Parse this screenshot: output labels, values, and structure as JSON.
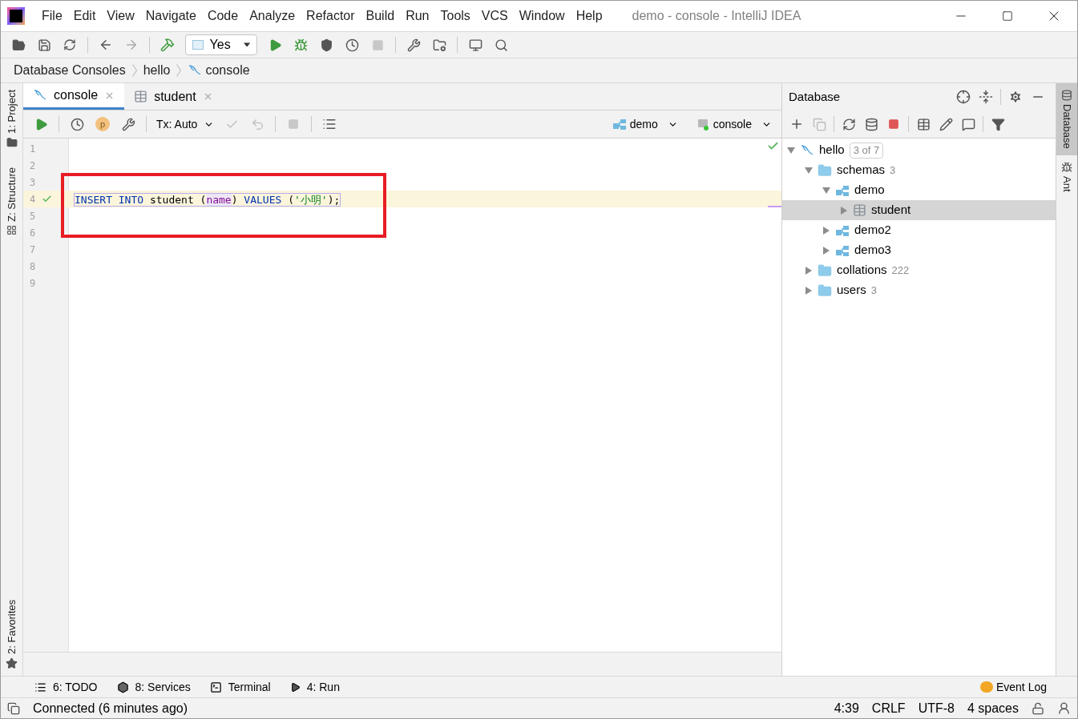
{
  "window": {
    "title": "demo - console - IntelliJ IDEA"
  },
  "menu": [
    "File",
    "Edit",
    "View",
    "Navigate",
    "Code",
    "Analyze",
    "Refactor",
    "Build",
    "Run",
    "Tools",
    "VCS",
    "Window",
    "Help"
  ],
  "toolbar": {
    "run_config": "Yes"
  },
  "breadcrumbs": [
    {
      "label": "Database Consoles",
      "kind": "plain"
    },
    {
      "label": "hello",
      "kind": "plain"
    },
    {
      "label": "console",
      "kind": "console"
    }
  ],
  "left_tool_windows": [
    {
      "label": "1: Project",
      "kind": "project"
    },
    {
      "label": "Z: Structure",
      "kind": "structure"
    },
    {
      "label": "2: Favorites",
      "kind": "favorites"
    }
  ],
  "editor_tabs": [
    {
      "label": "console",
      "kind": "console",
      "selected": true
    },
    {
      "label": "student",
      "kind": "table",
      "selected": false
    }
  ],
  "editor_toolbar": {
    "parameters": "p",
    "transaction": "Tx: Auto",
    "schema": "demo",
    "session": "console"
  },
  "editor": {
    "lines": [
      {
        "number": "1",
        "current": false
      },
      {
        "number": "2",
        "current": false
      },
      {
        "number": "3",
        "current": false
      },
      {
        "number": "4",
        "current": true,
        "executed": true,
        "tokens": [
          {
            "text": "INSERT INTO",
            "kind": "keyword"
          },
          {
            "text": " student (",
            "kind": "plain"
          },
          {
            "text": "name",
            "kind": "column"
          },
          {
            "text": ") ",
            "kind": "plain"
          },
          {
            "text": "VALUES",
            "kind": "keyword"
          },
          {
            "text": " (",
            "kind": "plain"
          },
          {
            "text": "'小明'",
            "kind": "string"
          },
          {
            "text": ");",
            "kind": "plain"
          }
        ]
      },
      {
        "number": "5",
        "current": false
      },
      {
        "number": "6",
        "current": false
      },
      {
        "number": "7",
        "current": false
      },
      {
        "number": "8",
        "current": false
      },
      {
        "number": "9",
        "current": false
      }
    ]
  },
  "database_panel": {
    "title": "Database",
    "tree": [
      {
        "label": "hello",
        "kind": "connection",
        "count": "3 of 7",
        "expanded": true,
        "selected": false,
        "children": [
          {
            "label": "schemas",
            "kind": "folder",
            "count": "3",
            "expanded": true,
            "selected": false,
            "children": [
              {
                "label": "demo",
                "kind": "schema",
                "expanded": true,
                "selected": false,
                "children": [
                  {
                    "label": "student",
                    "kind": "table",
                    "expanded": false,
                    "selected": true
                  }
                ]
              },
              {
                "label": "demo2",
                "kind": "schema",
                "expanded": false,
                "selected": false
              },
              {
                "label": "demo3",
                "kind": "schema",
                "expanded": false,
                "selected": false
              }
            ]
          },
          {
            "label": "collations",
            "kind": "folder",
            "count": "222",
            "expanded": false,
            "selected": false
          },
          {
            "label": "users",
            "kind": "folder",
            "count": "3",
            "expanded": false,
            "selected": false
          }
        ]
      }
    ]
  },
  "right_tool_windows": [
    {
      "label": "Database",
      "kind": "database",
      "selected": true
    },
    {
      "label": "Ant",
      "kind": "ant",
      "selected": false
    }
  ],
  "bottom_tools": [
    {
      "label": "6: TODO",
      "kind": "todo"
    },
    {
      "label": "8: Services",
      "kind": "services"
    },
    {
      "label": "Terminal",
      "kind": "terminal"
    },
    {
      "label": "4: Run",
      "kind": "run"
    }
  ],
  "event_log": "Event Log",
  "status_bar": {
    "message": "Connected (6 minutes ago)",
    "position": "4:39",
    "line_separator": "CRLF",
    "encoding": "UTF-8",
    "indent": "4 spaces"
  }
}
